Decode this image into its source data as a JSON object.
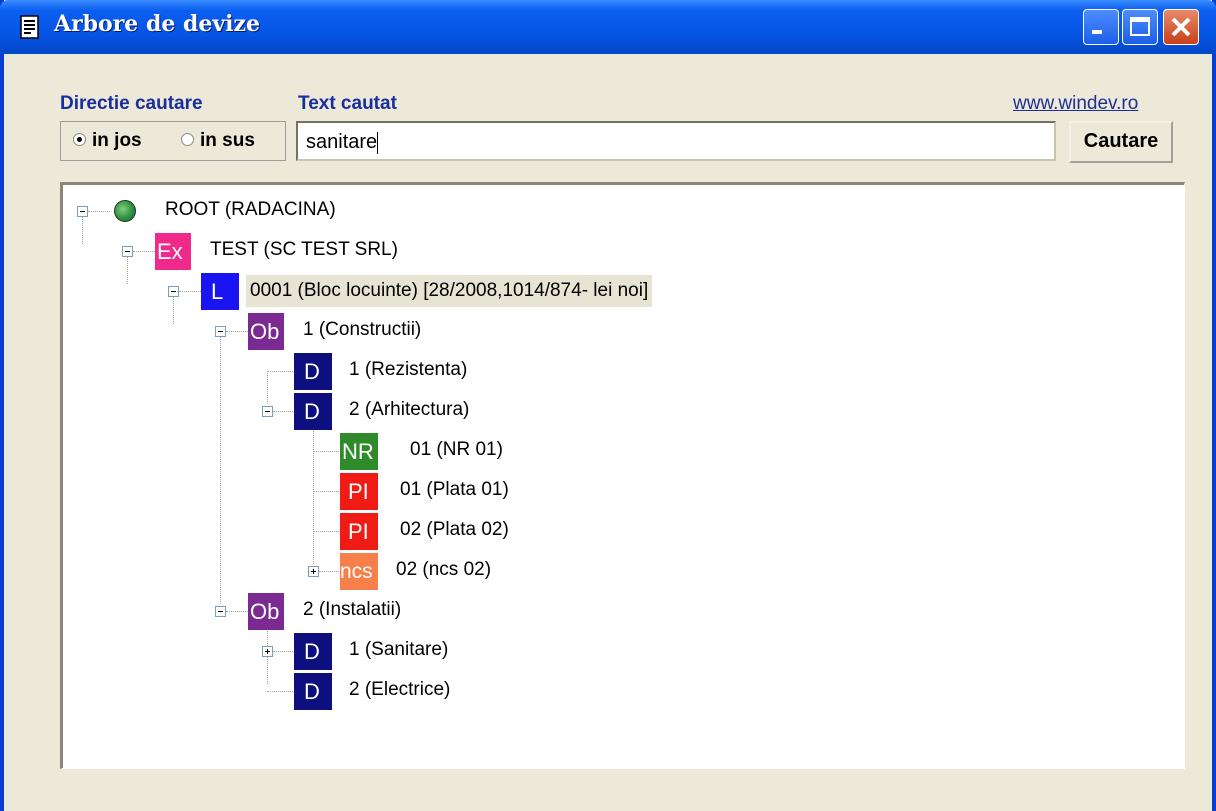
{
  "window": {
    "title": "Arbore de devize"
  },
  "search_panel": {
    "direction_label": "Directie cautare",
    "text_label": "Text cautat",
    "radio_down": "in jos",
    "radio_up": "in sus",
    "search_value": "sanitare",
    "link": "www.windev.ro",
    "search_button": "Cautare"
  },
  "tree": {
    "nodes": [
      {
        "icon": "",
        "label": "ROOT (RADACINA)"
      },
      {
        "icon": "Ex",
        "label": "TEST (SC TEST SRL)"
      },
      {
        "icon": "L",
        "label": "0001 (Bloc locuinte) [28/2008,1014/874- lei noi]"
      },
      {
        "icon": "Ob",
        "label": "1 (Constructii)"
      },
      {
        "icon": "D",
        "label": "1 (Rezistenta)"
      },
      {
        "icon": "D",
        "label": "2 (Arhitectura)"
      },
      {
        "icon": "NR",
        "label": "01 (NR 01)"
      },
      {
        "icon": "PI",
        "label": "01 (Plata 01)"
      },
      {
        "icon": "PI",
        "label": "02 (Plata 02)"
      },
      {
        "icon": "ncs",
        "label": "02 (ncs 02)"
      },
      {
        "icon": "Ob",
        "label": "2 (Instalatii)"
      },
      {
        "icon": "D",
        "label": "1 (Sanitare)"
      },
      {
        "icon": "D",
        "label": "2 (Electrice)"
      }
    ]
  },
  "colors": {
    "Ex": "#f0298a",
    "L": "#1b14f2",
    "Ob": "#7a2a91",
    "D": "#0d0f7e",
    "NR": "#2f8b2a",
    "PI": "#ef1b14",
    "ncs": "#f77f4a"
  }
}
